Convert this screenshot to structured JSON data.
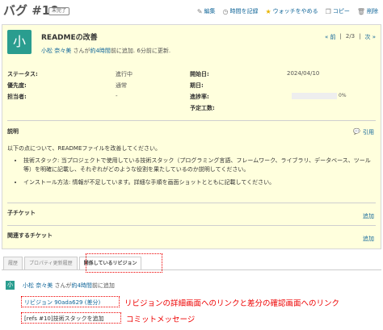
{
  "header": {
    "title": "バグ #10",
    "status_badge": "未完了",
    "actions": [
      {
        "icon": "edit-icon",
        "label": "編集"
      },
      {
        "icon": "clock-icon",
        "label": "時間を記録"
      },
      {
        "icon": "star-icon",
        "label": "ウォッチをやめる"
      },
      {
        "icon": "copy-icon",
        "label": "コピー"
      },
      {
        "icon": "trash-icon",
        "label": "削除"
      }
    ]
  },
  "issue": {
    "avatar_initial": "小",
    "subject": "READMEの改善",
    "author": "小松 奈々美",
    "author_middle": " さんが",
    "created_ago": "約4時間",
    "author_tail": "前に追加. 6分前に更新.",
    "pager": {
      "prev": "« 前",
      "count": "2/3",
      "next": "次 »"
    },
    "attributes": {
      "status_label": "ステータス:",
      "status_value": "進行中",
      "priority_label": "優先度:",
      "priority_value": "通常",
      "assignee_label": "担当者:",
      "assignee_value": "-",
      "start_label": "開始日:",
      "start_value": "2024/04/10",
      "due_label": "期日:",
      "due_value": "",
      "progress_label": "進捗率:",
      "progress_value": "0%",
      "progress": 0,
      "estimate_label": "予定工数:",
      "estimate_value": ""
    },
    "description": {
      "title": "説明",
      "quote": "引用",
      "intro": "以下の点について、READMEファイルを改善してください。",
      "items": [
        "技術スタック: 当プロジェクトで使用している技術スタック（プログラミング言語、フレームワーク、ライブラリ、データベース、ツール等）を明確に記載し、それぞれがどのような役割を果たしているのか説明してください。",
        "インストール方法: 情報が不足しています。詳細な手順を画面ショットとともに記載してください。"
      ]
    },
    "subtasks": {
      "title": "子チケット",
      "add": "追加"
    },
    "relations": {
      "title": "関連するチケット",
      "add": "追加"
    }
  },
  "tabs": [
    "履歴",
    "プロパティ更新履歴",
    "関係しているリビジョン"
  ],
  "revision": {
    "avatar_initial": "小",
    "author": "小松 奈々美",
    "author_middle": " さんが",
    "created_ago": "約4時間",
    "author_tail": "前に追加",
    "link_text": "リビジョン 90ada629 (差分)",
    "note1": "リビジョンの詳細画面へのリンクと差分の確認画面へのリンク",
    "message": "[refs #10]技術スタックを追加",
    "note2": "コミットメッセージ"
  },
  "colors": {
    "accent": "#116699",
    "annotation": "#ee0000",
    "issue_bg": "#ffffdd",
    "avatar_bg": "#2a9d8f"
  }
}
